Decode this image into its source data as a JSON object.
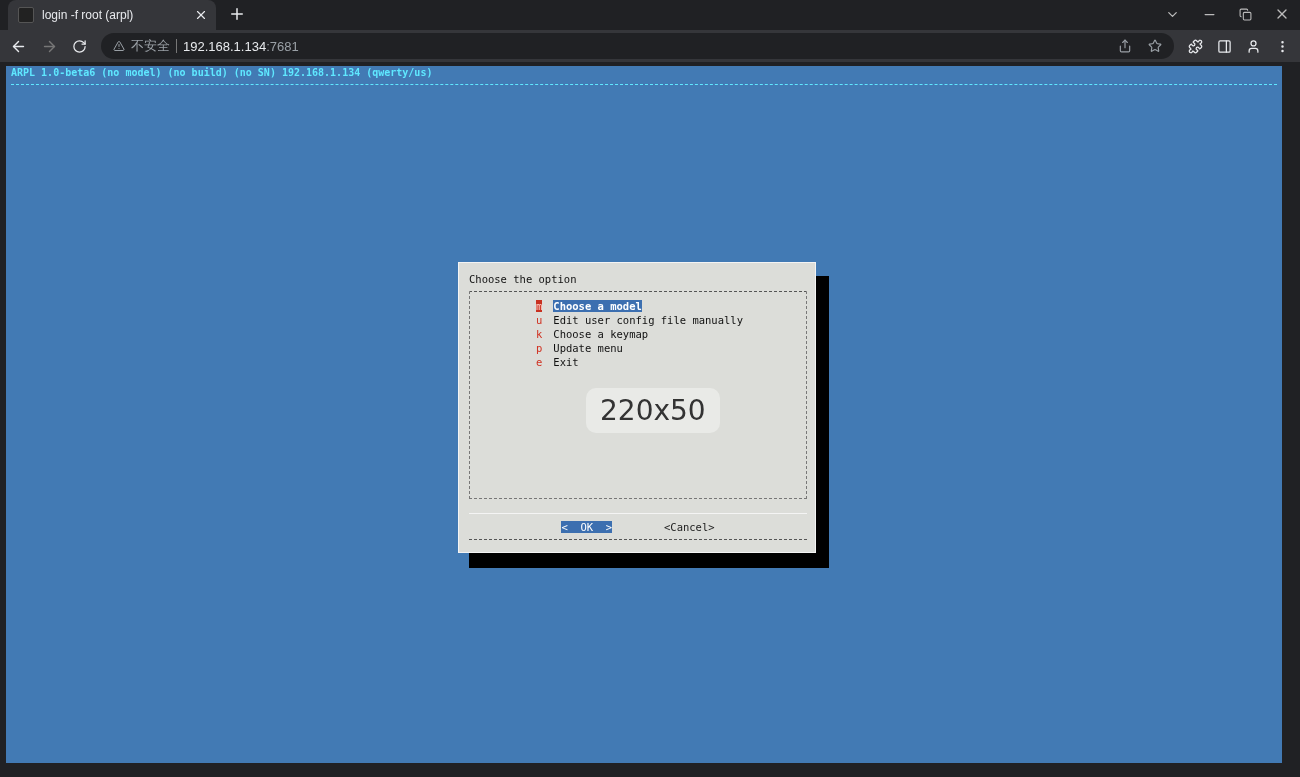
{
  "browser": {
    "tab": {
      "title": "login -f root (arpl)"
    },
    "address": {
      "security": "不安全",
      "host": "192.168.1.134",
      "port": ":7681"
    }
  },
  "terminal": {
    "header": "ARPL 1.0-beta6 (no model) (no build) (no SN) 192.168.1.134 (qwerty/us)",
    "dialog": {
      "title": "Choose the option",
      "items": [
        {
          "key": "m",
          "label": "Choose a model",
          "selected": true
        },
        {
          "key": "u",
          "label": "Edit user config file manually",
          "selected": false
        },
        {
          "key": "k",
          "label": "Choose a keymap",
          "selected": false
        },
        {
          "key": "p",
          "label": "Update menu",
          "selected": false
        },
        {
          "key": "e",
          "label": "Exit",
          "selected": false
        }
      ],
      "buttons": [
        {
          "label": "<  OK  >",
          "selected": true
        },
        {
          "label": "<Cancel>",
          "selected": false
        }
      ]
    },
    "size_overlay": "220x50"
  }
}
